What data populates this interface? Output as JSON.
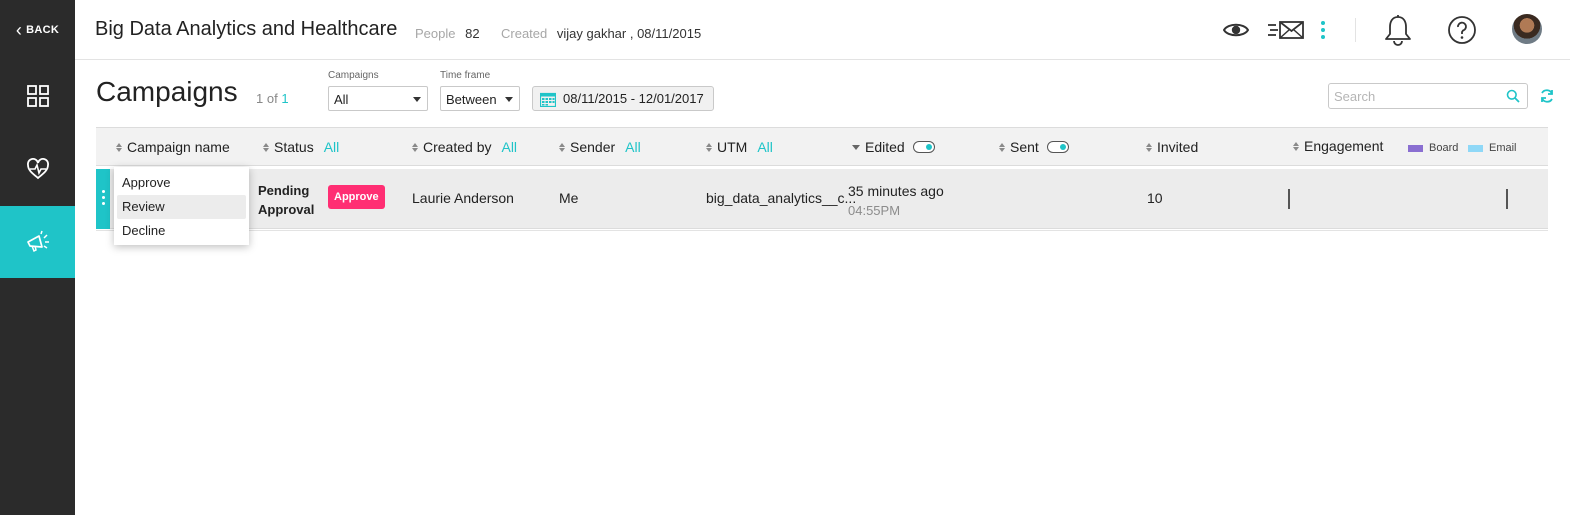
{
  "sidebar": {
    "back_label": "BACK",
    "items": [
      {
        "icon": "dashboard-grid-icon"
      },
      {
        "icon": "heart-pulse-icon"
      },
      {
        "icon": "megaphone-icon",
        "active": true
      }
    ]
  },
  "header": {
    "title": "Big Data Analytics and Healthcare",
    "people_label": "People",
    "people_count": "82",
    "created_label": "Created",
    "created_value": "vijay gakhar , 08/11/2015",
    "icons": [
      "eye-icon",
      "mail-send-icon",
      "more-vertical-icon",
      "bell-icon",
      "help-icon",
      "avatar"
    ]
  },
  "toolbar": {
    "page_title": "Campaigns",
    "counter_prefix": "1 of",
    "counter_total": "1",
    "campaigns_label": "Campaigns",
    "campaigns_value": "All",
    "timeframe_label": "Time frame",
    "timeframe_value": "Between",
    "date_range": "08/11/2015 - 12/01/2017",
    "search_placeholder": "Search"
  },
  "table": {
    "columns": {
      "campaign_name": "Campaign name",
      "status": "Status",
      "status_filter": "All",
      "created_by": "Created by",
      "created_by_filter": "All",
      "sender": "Sender",
      "sender_filter": "All",
      "utm": "UTM",
      "utm_filter": "All",
      "edited": "Edited",
      "sent": "Sent",
      "invited": "Invited",
      "engagement": "Engagement"
    },
    "legend": {
      "board": "Board",
      "email": "Email"
    },
    "colors": {
      "board": "#8a6fd1",
      "email": "#8fd8f7",
      "accent": "#1fc4c8",
      "approve": "#ff2e73"
    },
    "rows": [
      {
        "status_line1": "Pending",
        "status_line2": "Approval",
        "status_action": "Approve",
        "created_by": "Laurie Anderson",
        "sender": "Me",
        "utm": "big_data_analytics__c...",
        "edited_ago": "35 minutes ago",
        "edited_time": "04:55PM",
        "invited": "10"
      }
    ]
  },
  "row_menu": {
    "items": [
      "Approve",
      "Review",
      "Decline"
    ],
    "highlighted": "Review"
  }
}
